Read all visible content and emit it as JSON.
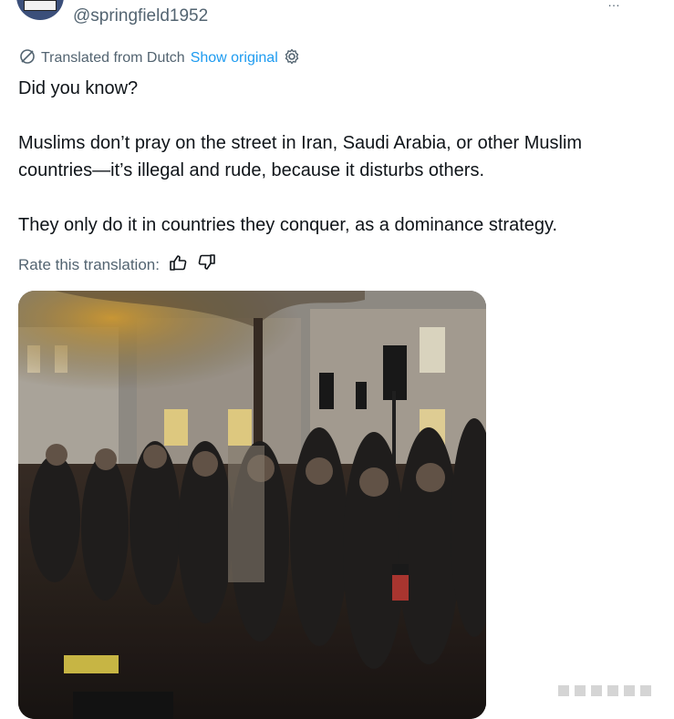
{
  "header": {
    "handle": "@springfield1952",
    "top_right_mark": "…"
  },
  "translation_bar": {
    "label": "Translated from Dutch",
    "show_original": "Show original"
  },
  "tweet": {
    "paragraphs": [
      "Did you know?",
      "Muslims don’t pray on the street in Iran, Saudi Arabia, or other Muslim countries—it’s illegal and rude, because it disturbs others.",
      "They only do it in countries they conquer, as a dominance strategy."
    ]
  },
  "rate": {
    "label": "Rate this translation:"
  },
  "media": {
    "kind": "photo",
    "subject": "crowd praying on city street at night"
  },
  "colors": {
    "text": "#0f1419",
    "secondary": "#536471",
    "link": "#1d9bf0"
  }
}
